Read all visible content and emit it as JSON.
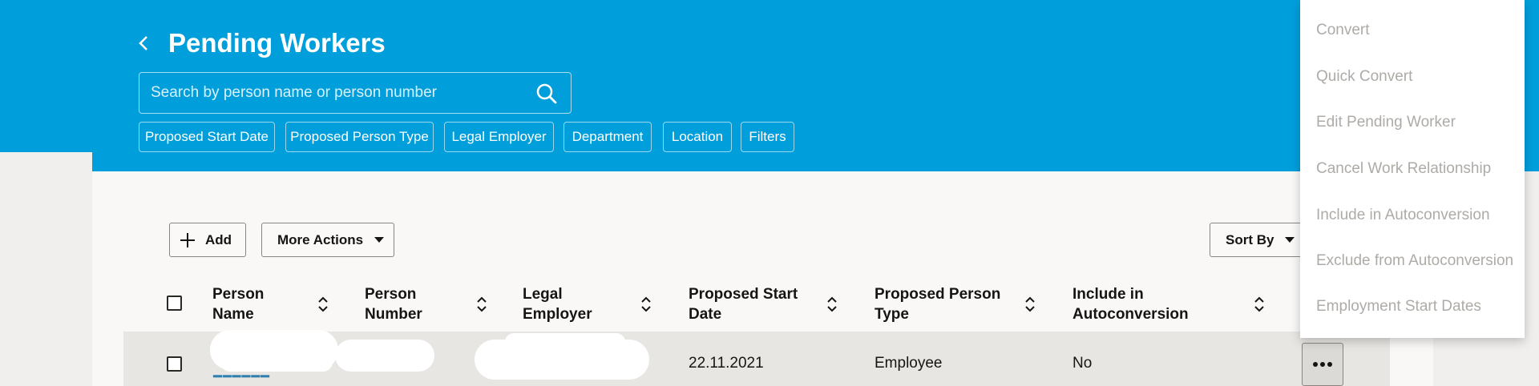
{
  "header": {
    "title": "Pending Workers",
    "back_icon": "chevron-left-icon",
    "search_placeholder": "Search by person name or person number",
    "search_icon": "search-icon",
    "background_color": "#009fdc",
    "filter_chips": [
      {
        "label": "Proposed Start Date"
      },
      {
        "label": "Proposed Person Type"
      },
      {
        "label": "Legal Employer"
      },
      {
        "label": "Department"
      },
      {
        "label": "Location"
      },
      {
        "label": "Filters"
      }
    ]
  },
  "toolbar": {
    "add_label": "Add",
    "add_icon": "plus-icon",
    "more_actions_label": "More Actions",
    "sort_by_label": "Sort By"
  },
  "table": {
    "columns": [
      {
        "line1": "Person",
        "line2": "Name"
      },
      {
        "line1": "Person",
        "line2": "Number"
      },
      {
        "line1": "Legal",
        "line2": "Employer"
      },
      {
        "line1": "Proposed Start",
        "line2": "Date"
      },
      {
        "line1": "Proposed Person",
        "line2": "Type"
      },
      {
        "line1": "Include in",
        "line2": "Autoconversion"
      }
    ],
    "rows": [
      {
        "proposed_start_date": "22.11.2021",
        "proposed_person_type": "Employee",
        "include_in_autoconversion": "No"
      }
    ]
  },
  "actions_menu": {
    "items": [
      {
        "label": "Convert"
      },
      {
        "label": "Quick Convert"
      },
      {
        "label": "Edit Pending Worker"
      },
      {
        "label": "Cancel Work Relationship"
      },
      {
        "label": "Include in Autoconversion"
      },
      {
        "label": "Exclude from Autoconversion"
      },
      {
        "label": "Employment Start Dates"
      }
    ],
    "disabled_color": "#aeaba7"
  }
}
